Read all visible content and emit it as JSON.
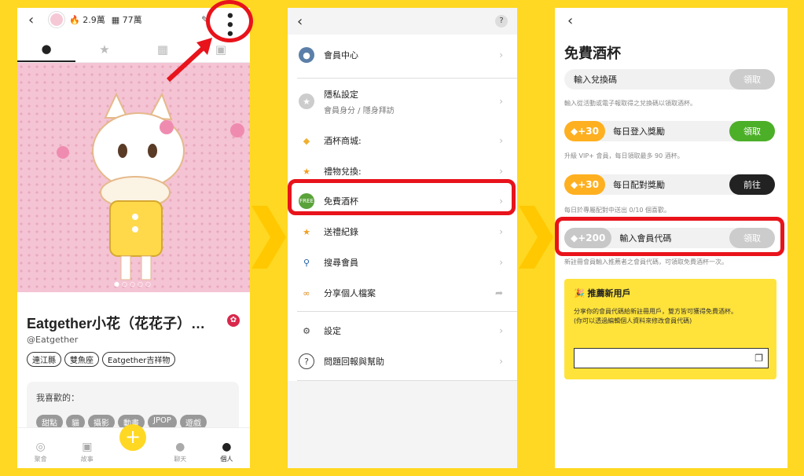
{
  "panel1": {
    "stats": {
      "fans": "2.9萬",
      "cups": "77萬"
    },
    "name": "Eatgether小花（花花子）…",
    "handle": "@Eatgether",
    "tags": [
      "連江縣",
      "雙魚座",
      "Eatgether吉祥物"
    ],
    "likes_label": "我喜歡的：",
    "likes": [
      "甜點",
      "貓",
      "攝影",
      "動畫",
      "JPOP",
      "遊戲"
    ],
    "nav": [
      "聚會",
      "故事",
      "聊天",
      "個人"
    ],
    "add_label": "+"
  },
  "panel2": {
    "help": "?",
    "items": [
      {
        "label": "會員中心",
        "icon": "user-circle-icon"
      },
      {
        "label": "隱私設定",
        "sub": "會員身分 / 隱身拜訪",
        "icon": "privacy-icon"
      },
      {
        "label": "酒杯商城:",
        "icon": "cup-shop-icon"
      },
      {
        "label": "禮物兌換:",
        "icon": "star-icon"
      },
      {
        "label": "免費酒杯",
        "icon": "free-icon"
      },
      {
        "label": "送禮紀錄",
        "icon": "gift-record-icon"
      },
      {
        "label": "搜尋會員",
        "icon": "search-icon"
      },
      {
        "label": "分享個人檔案",
        "icon": "link-icon"
      },
      {
        "label": "設定",
        "icon": "gear-icon"
      },
      {
        "label": "問題回報與幫助",
        "icon": "question-icon"
      }
    ]
  },
  "panel3": {
    "title": "免費酒杯",
    "redeem": {
      "label": "輸入兌換碼",
      "button": "領取",
      "hint": "輸入從活動或電子報取得之兌換碼以領取酒杯。"
    },
    "daily": {
      "amount": "+30",
      "label": "每日登入獎勵",
      "button": "領取",
      "hint": "升級 VIP+ 會員，每日領取最多 90 酒杯。"
    },
    "match": {
      "amount": "+30",
      "label": "每日配對獎勵",
      "button": "前往",
      "hint": "每日於專屬配對中送出 0/10 個喜歡。"
    },
    "invite": {
      "amount": "+200",
      "label": "輸入會員代碼",
      "button": "領取",
      "hint": "新註冊會員輸入推薦者之會員代碼，可領取免費酒杯一次。"
    },
    "refer": {
      "title": "推薦新用戶",
      "desc": "分享你的會員代碼給新註冊用戶，雙方皆可獲得免費酒杯。",
      "note": "(你可以透過編輯個人資料來修改會員代碼)"
    }
  },
  "colors": {
    "accent": "#FFD823",
    "highlight": "#e8131b",
    "green": "#4CAF28",
    "dark": "#222222"
  }
}
